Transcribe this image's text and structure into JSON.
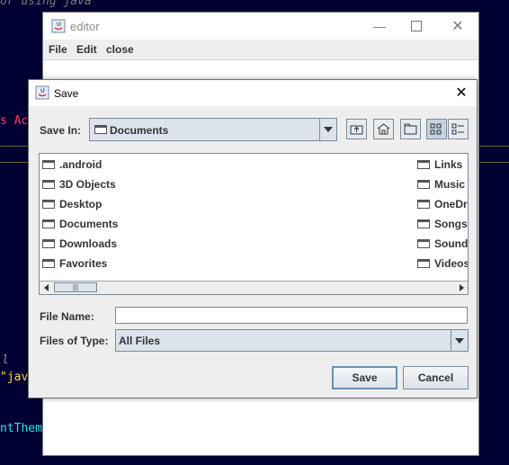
{
  "background": {
    "top_comment": "or using java",
    "red_text": "s Ac",
    "italic_letter": "l",
    "yellow_text": "\"jav",
    "cyan_text": "ntTheme"
  },
  "editor": {
    "title": "editor",
    "menu": [
      "File",
      "Edit",
      "close"
    ]
  },
  "dialog": {
    "title": "Save",
    "save_in_label": "Save In:",
    "save_in_value": "Documents",
    "files_left": [
      ".android",
      "3D Objects",
      "Desktop",
      "Documents",
      "Downloads",
      "Favorites"
    ],
    "files_right": [
      "Links",
      "Music",
      "OneDr",
      "Songs",
      "Sound",
      "Videos"
    ],
    "file_name_label": "File Name:",
    "file_name_value": "",
    "files_of_type_label": "Files of Type:",
    "files_of_type_value": "All Files",
    "save_button": "Save",
    "cancel_button": "Cancel"
  },
  "icons": {
    "up_folder": "up-one-level-icon",
    "home": "home-icon",
    "new_folder": "new-folder-icon",
    "list_view": "list-view-icon",
    "details_view": "details-view-icon"
  }
}
